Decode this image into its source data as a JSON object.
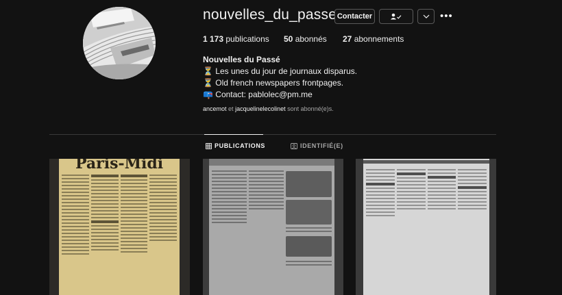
{
  "profile": {
    "username": "nouvelles_du_passe",
    "contact_label": "Contacter",
    "more_label": "•••",
    "stats": {
      "posts_count": "1 173",
      "posts_label": "publications",
      "followers_count": "50",
      "followers_label": "abonnés",
      "following_count": "27",
      "following_label": "abonnements"
    },
    "bio": {
      "name": "Nouvelles du Passé",
      "line1": "⏳ Les unes du jour de journaux disparus.",
      "line2": "⏳ Old french newspapers frontpages.",
      "line3": "📪 Contact: pablolec@pm.me"
    },
    "followed_by": {
      "user1": "ancemot",
      "and": "et",
      "user2": "jacquelinelecolinet",
      "suffix": "sont abonné(e)s."
    }
  },
  "tabs": [
    {
      "label": "PUBLICATIONS",
      "active": true,
      "icon": "grid-icon"
    },
    {
      "label": "IDENTIFIÉ(E)",
      "active": false,
      "icon": "tagged-icon"
    }
  ],
  "posts": [
    {
      "masthead": "Paris-Midi",
      "tone": "sepia"
    },
    {
      "masthead": "",
      "tone": "grey"
    },
    {
      "masthead": "",
      "tone": "light"
    }
  ],
  "colors": {
    "background": "#121212",
    "text": "#f5f5f5",
    "muted": "#a8a8a8",
    "border": "#5a5a5a"
  }
}
